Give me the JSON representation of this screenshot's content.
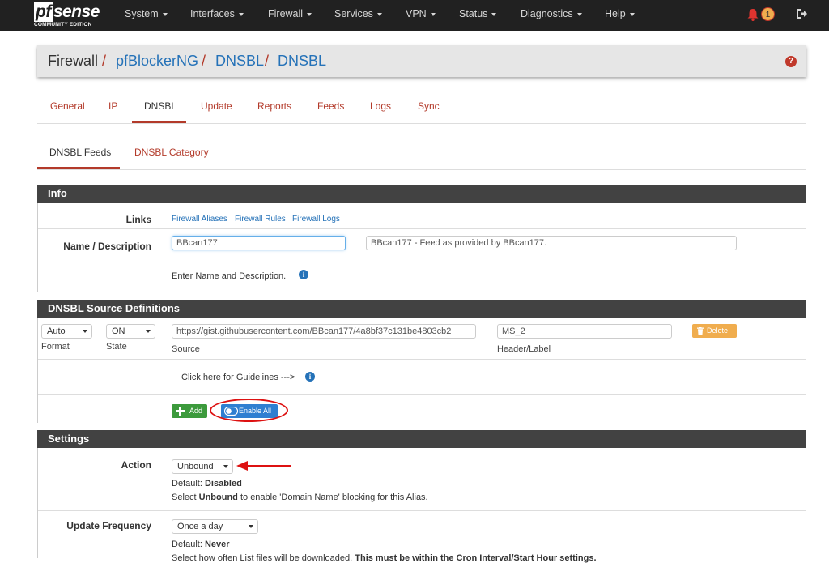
{
  "brand": {
    "name": "sense",
    "name_prefix": "pf",
    "edition": "COMMUNITY EDITION"
  },
  "nav": {
    "items": [
      {
        "label": "System"
      },
      {
        "label": "Interfaces"
      },
      {
        "label": "Firewall"
      },
      {
        "label": "Services"
      },
      {
        "label": "VPN"
      },
      {
        "label": "Status"
      },
      {
        "label": "Diagnostics"
      },
      {
        "label": "Help"
      }
    ],
    "notification_count": "1"
  },
  "breadcrumb": {
    "parts": [
      "Firewall",
      "pfBlockerNG",
      "DNSBL",
      "DNSBL"
    ],
    "separator": "/"
  },
  "tabs": {
    "main": [
      "General",
      "IP",
      "DNSBL",
      "Update",
      "Reports",
      "Feeds",
      "Logs",
      "Sync"
    ],
    "main_active": "DNSBL",
    "sub": [
      "DNSBL Feeds",
      "DNSBL Category"
    ],
    "sub_active": "DNSBL Feeds"
  },
  "info_panel": {
    "title": "Info",
    "links_label": "Links",
    "links": [
      "Firewall Aliases",
      "Firewall Rules",
      "Firewall Logs"
    ],
    "name_label": "Name / Description",
    "name_value": "BBcan177",
    "description_value": "BBcan177 - Feed as provided by BBcan177.",
    "help": "Enter Name and Description."
  },
  "source_panel": {
    "title": "DNSBL Source Definitions",
    "format_value": "Auto",
    "format_label": "Format",
    "state_value": "ON",
    "state_label": "State",
    "source_value": "https://gist.githubusercontent.com/BBcan177/4a8bf37c131be4803cb2",
    "source_label": "Source",
    "header_value": "MS_2",
    "header_label": "Header/Label",
    "delete_label": "Delete",
    "guidelines": "Click here for Guidelines --->",
    "add_label": "Add",
    "enable_all_label": "Enable All"
  },
  "settings_panel": {
    "title": "Settings",
    "action_label": "Action",
    "action_value": "Unbound",
    "action_default_prefix": "Default: ",
    "action_default": "Disabled",
    "action_help_prefix": "Select ",
    "action_help_bold": "Unbound",
    "action_help_suffix": " to enable 'Domain Name' blocking for this Alias.",
    "freq_label": "Update Frequency",
    "freq_value": "Once a day",
    "freq_default_prefix": "Default: ",
    "freq_default": "Never",
    "freq_help": "Select how often List files will be downloaded.",
    "freq_help_bold": "This must be within the Cron Interval/Start Hour settings."
  },
  "colors": {
    "accent": "#b33a2a",
    "navbar": "#212121",
    "panel_header": "#424242",
    "link": "#2572b8",
    "add_button": "#3c9a3c",
    "enable_button": "#2f7fd1",
    "delete_button": "#f0ad4e",
    "annotation_red": "#dd1111"
  }
}
